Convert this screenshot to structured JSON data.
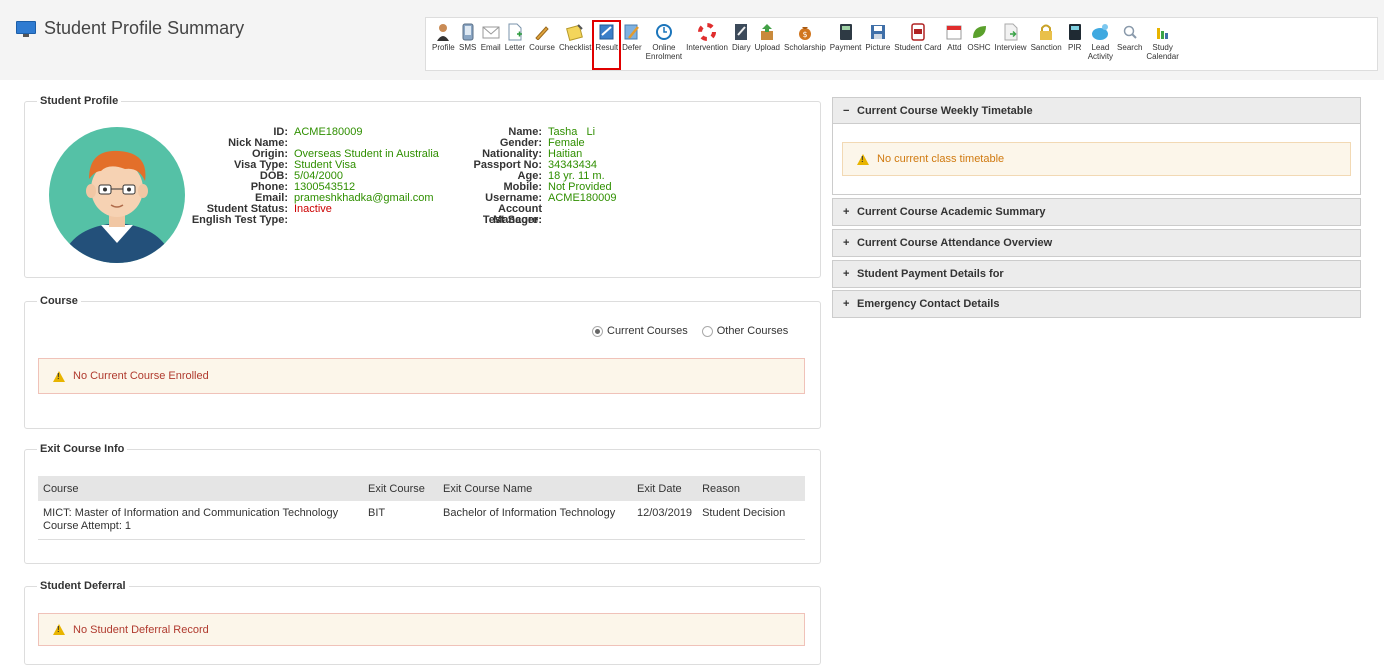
{
  "page": {
    "title": "Student Profile Summary"
  },
  "toolbar": [
    {
      "label": "Profile",
      "icon": "person-icon"
    },
    {
      "label": "SMS",
      "icon": "phone-icon"
    },
    {
      "label": "Email",
      "icon": "envelope-icon"
    },
    {
      "label": "Letter",
      "icon": "document-icon"
    },
    {
      "label": "Course",
      "icon": "pencil-icon"
    },
    {
      "label": "Checklist",
      "icon": "checklist-icon"
    },
    {
      "label": "Result",
      "icon": "result-icon",
      "selected": true
    },
    {
      "label": "Defer",
      "icon": "defer-icon"
    },
    {
      "label": "Online\nEnrolment",
      "icon": "clock-icon"
    },
    {
      "label": "Intervention",
      "icon": "lifebuoy-icon"
    },
    {
      "label": "Diary",
      "icon": "diary-icon"
    },
    {
      "label": "Upload",
      "icon": "upload-box-icon"
    },
    {
      "label": "Scholarship",
      "icon": "money-bag-icon"
    },
    {
      "label": "Payment",
      "icon": "calculator-icon"
    },
    {
      "label": "Picture",
      "icon": "save-icon"
    },
    {
      "label": "Student Card",
      "icon": "id-card-icon"
    },
    {
      "label": "Attd",
      "icon": "calendar-icon"
    },
    {
      "label": "OSHC",
      "icon": "leaf-icon"
    },
    {
      "label": "Interview",
      "icon": "interview-doc-icon"
    },
    {
      "label": "Sanction",
      "icon": "lock-icon"
    },
    {
      "label": "PIR",
      "icon": "pir-calculator-icon"
    },
    {
      "label": "Lead\nActivity",
      "icon": "lead-activity-icon"
    },
    {
      "label": "Search",
      "icon": "search-icon"
    },
    {
      "label": "Study\nCalendar",
      "icon": "bar-chart-icon"
    }
  ],
  "profile": {
    "legend": "Student Profile",
    "left": [
      {
        "label": "ID:",
        "value": "ACME180009"
      },
      {
        "label": "Nick Name:",
        "value": ""
      },
      {
        "label": "Origin:",
        "value": "Overseas Student in Australia"
      },
      {
        "label": "Visa Type:",
        "value": "Student Visa"
      },
      {
        "label": "DOB:",
        "value": "5/04/2000"
      },
      {
        "label": "Phone:",
        "value": "1300543512"
      },
      {
        "label": "Email:",
        "value": "prameshkhadka@gmail.com"
      },
      {
        "label": "Student Status:",
        "value": "Inactive",
        "status": "red"
      },
      {
        "label": "English Test Type:",
        "value": ""
      }
    ],
    "right": [
      {
        "label": "Name:",
        "value": "Tasha   Li"
      },
      {
        "label": "Gender:",
        "value": "Female"
      },
      {
        "label": "Nationality:",
        "value": "Haitian"
      },
      {
        "label": "Passport No:",
        "value": "34343434"
      },
      {
        "label": "Age:",
        "value": "18 yr. 11 m."
      },
      {
        "label": "Mobile:",
        "value": "Not Provided"
      },
      {
        "label": "Username:",
        "value": "ACME180009"
      },
      {
        "label": "Account Manager:",
        "value": ""
      },
      {
        "label": "Test Score:",
        "value": ""
      }
    ]
  },
  "course": {
    "legend": "Course",
    "radio_current": "Current Courses",
    "radio_other": "Other Courses",
    "alert": "No Current Course Enrolled"
  },
  "exit_course": {
    "legend": "Exit Course Info",
    "headers": [
      "Course",
      "Exit Course",
      "Exit Course Name",
      "Exit Date",
      "Reason"
    ],
    "rows": [
      {
        "course": "MICT: Master of Information and Communication Technology",
        "attempt": "Course Attempt: 1",
        "exit_course": "BIT",
        "exit_course_name": "Bachelor of Information Technology",
        "exit_date": "12/03/2019",
        "reason": "Student Decision"
      }
    ]
  },
  "deferral": {
    "legend": "Student Deferral",
    "alert": "No Student Deferral Record"
  },
  "right_panels": {
    "timetable": {
      "sign": "−",
      "title": "Current Course Weekly Timetable",
      "alert": "No current class timetable"
    },
    "academic": {
      "sign": "+",
      "title": "Current Course Academic Summary"
    },
    "attendance": {
      "sign": "+",
      "title": "Current Course Attendance Overview"
    },
    "payment": {
      "sign": "+",
      "title": "Student Payment Details for"
    },
    "emergency": {
      "sign": "+",
      "title": "Emergency Contact Details"
    }
  },
  "colors": {
    "value_green": "#2f8f00",
    "status_red": "#cc0000",
    "selected_outline": "#e00000",
    "alert_bg": "#fcf6ea"
  }
}
